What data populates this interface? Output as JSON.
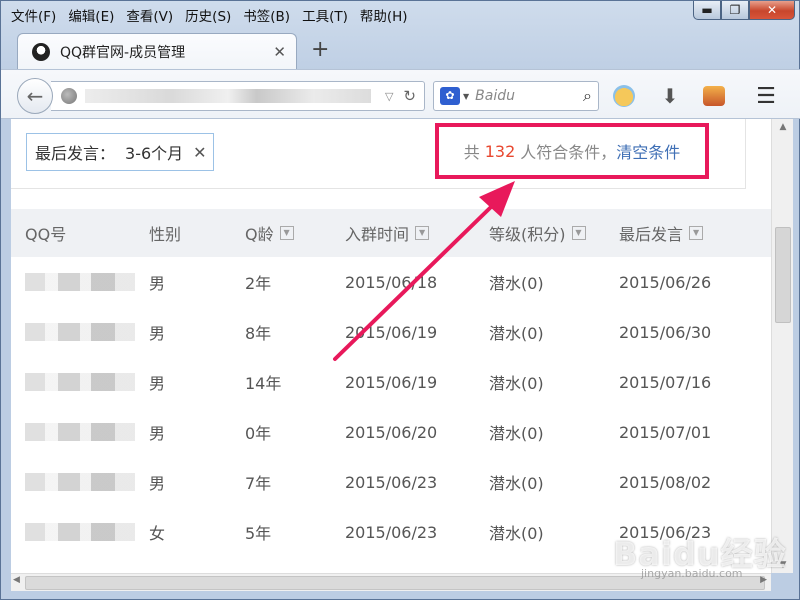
{
  "menu": [
    "文件(F)",
    "编辑(E)",
    "查看(V)",
    "历史(S)",
    "书签(B)",
    "工具(T)",
    "帮助(H)"
  ],
  "window_controls": {
    "minimize": "▬",
    "maximize": "❐",
    "close": "✕"
  },
  "tab": {
    "title": "QQ群官网-成员管理",
    "close": "✕",
    "new_tab": "+"
  },
  "search": {
    "placeholder": "Baidu"
  },
  "icons": {
    "back": "back-arrow-icon",
    "site": "globe-icon",
    "reload": "reload-icon",
    "search_engine": "baidu-paw-icon",
    "search_go": "magnifier-icon",
    "download": "download-arrow-icon",
    "menu": "hamburger-icon"
  },
  "filter": {
    "label": "最后发言：",
    "value": "3-6个月",
    "remove": "✕"
  },
  "result": {
    "prefix": "共",
    "count": "132",
    "suffix": "人符合条件，",
    "clear_link": "清空条件"
  },
  "table": {
    "headers": [
      "QQ号",
      "性别",
      "Q龄",
      "入群时间",
      "等级(积分)",
      "最后发言"
    ],
    "rows": [
      {
        "gender": "男",
        "qage": "2年",
        "join": "2015/06/18",
        "level": "潜水(0)",
        "last": "2015/06/26"
      },
      {
        "gender": "男",
        "qage": "8年",
        "join": "2015/06/19",
        "level": "潜水(0)",
        "last": "2015/06/30"
      },
      {
        "gender": "男",
        "qage": "14年",
        "join": "2015/06/19",
        "level": "潜水(0)",
        "last": "2015/07/16"
      },
      {
        "gender": "男",
        "qage": "0年",
        "join": "2015/06/20",
        "level": "潜水(0)",
        "last": "2015/07/01"
      },
      {
        "gender": "男",
        "qage": "7年",
        "join": "2015/06/23",
        "level": "潜水(0)",
        "last": "2015/08/02"
      },
      {
        "gender": "女",
        "qage": "5年",
        "join": "2015/06/23",
        "level": "潜水(0)",
        "last": "2015/06/23"
      }
    ]
  },
  "watermark": {
    "text": "Baidu经验",
    "sub": "jingyan.baidu.com"
  },
  "colors": {
    "highlight_box": "#e8195b",
    "count": "#e8472f",
    "link": "#3f6fb5",
    "arrow": "#e8195b"
  }
}
